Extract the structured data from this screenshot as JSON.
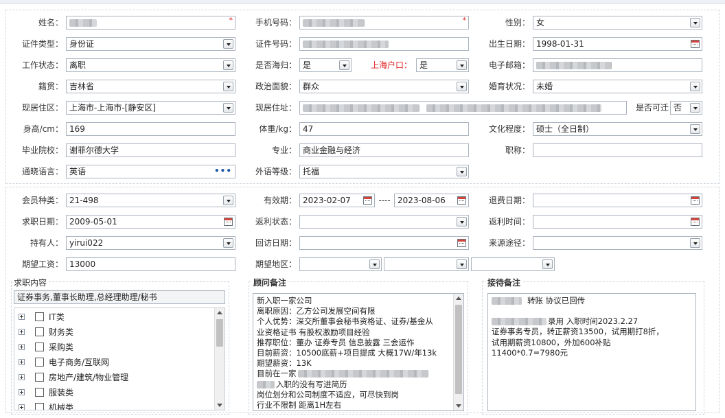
{
  "personal": {
    "name_label": "姓名：",
    "phone_label": "手机号码：",
    "gender_label": "性别：",
    "gender_value": "女",
    "id_type_label": "证件类型：",
    "id_type_value": "身份证",
    "id_no_label": "证件号码：",
    "birth_label": "出生日期：",
    "birth_value": "1998-01-31",
    "work_status_label": "工作状态：",
    "work_status_value": "离职",
    "overseas_label": "是否海归：",
    "overseas_value": "是",
    "hukou_label": "上海户口：",
    "hukou_value": "是",
    "email_label": "电子邮箱：",
    "origin_label": "籍贯：",
    "origin_value": "吉林省",
    "political_label": "政治面貌：",
    "political_value": "群众",
    "marital_label": "婚育状况：",
    "marital_value": "未婚",
    "residence_area_label": "现居住区：",
    "residence_area_value": "上海市-上海市-[静安区]",
    "address_label": "现居住址：",
    "reachable_label": "是否可迁",
    "reachable_value": "否",
    "height_label": "身高/cm：",
    "height_value": "169",
    "weight_label": "体重/kg：",
    "weight_value": "47",
    "education_label": "文化程度：",
    "education_value": "硕士（全日制）",
    "school_label": "毕业院校：",
    "school_value": "谢菲尔德大学",
    "major_label": "专业：",
    "major_value": "商业金融与经济",
    "title_label": "职称：",
    "language_label": "通晓语言：",
    "language_value": "英语",
    "foreign_level_label": "外语等级：",
    "foreign_level_value": "托福",
    "required_mark": "*"
  },
  "membership": {
    "member_type_label": "会员种类：",
    "member_type_value": "21-498",
    "valid_label": "有效期：",
    "valid_from": "2023-02-07",
    "valid_sep": "----",
    "valid_to": "2023-08-06",
    "refund_date_label": "退费日期：",
    "job_date_label": "求职日期：",
    "job_date_value": "2009-05-01",
    "rebate_status_label": "返利状态：",
    "rebate_time_label": "返利时间：",
    "holder_label": "持有人：",
    "holder_value": "yirui022",
    "visit_date_label": "回访日期：",
    "source_label": "来源途径：",
    "salary_label": "期望工资：",
    "salary_value": "13000",
    "region_label": "期望地区："
  },
  "job_content": {
    "title": "求职内容",
    "selected": "证券事务,董事长助理,总经理助理/秘书",
    "categories": [
      "IT类",
      "财务类",
      "采购类",
      "电子商务/互联网",
      "房地产/建筑/物业管理",
      "服装类",
      "机械类"
    ]
  },
  "consultant_notes": {
    "title": "顾问备注",
    "lines": [
      "新入职一家公司",
      "离职原因：乙方公司发展空间有限",
      "个人优势：深交所董事会秘书资格证、证券/基金从",
      "业资格证书  有股权激励项目经验",
      "推荐职位：董办 证券专员 信息披露 三会运作",
      "目前薪资：10500底薪+项目提成  大概17W/年13k",
      "期望薪资：13K",
      "目前在一家",
      "入职的没有写进简历",
      "岗位划分和公司制度不适应，可尽快到岗",
      "行业不限制  距离1H左右"
    ]
  },
  "reception_notes": {
    "title": "接待备注",
    "lines": [
      "转账 协议已回传",
      "",
      "录用 入职时间2023.2.27",
      "证券事务专员，转正薪资13500，试用期打8折，",
      "试用期薪资10800，外加600补贴",
      "11400*0.7=7980元"
    ]
  }
}
